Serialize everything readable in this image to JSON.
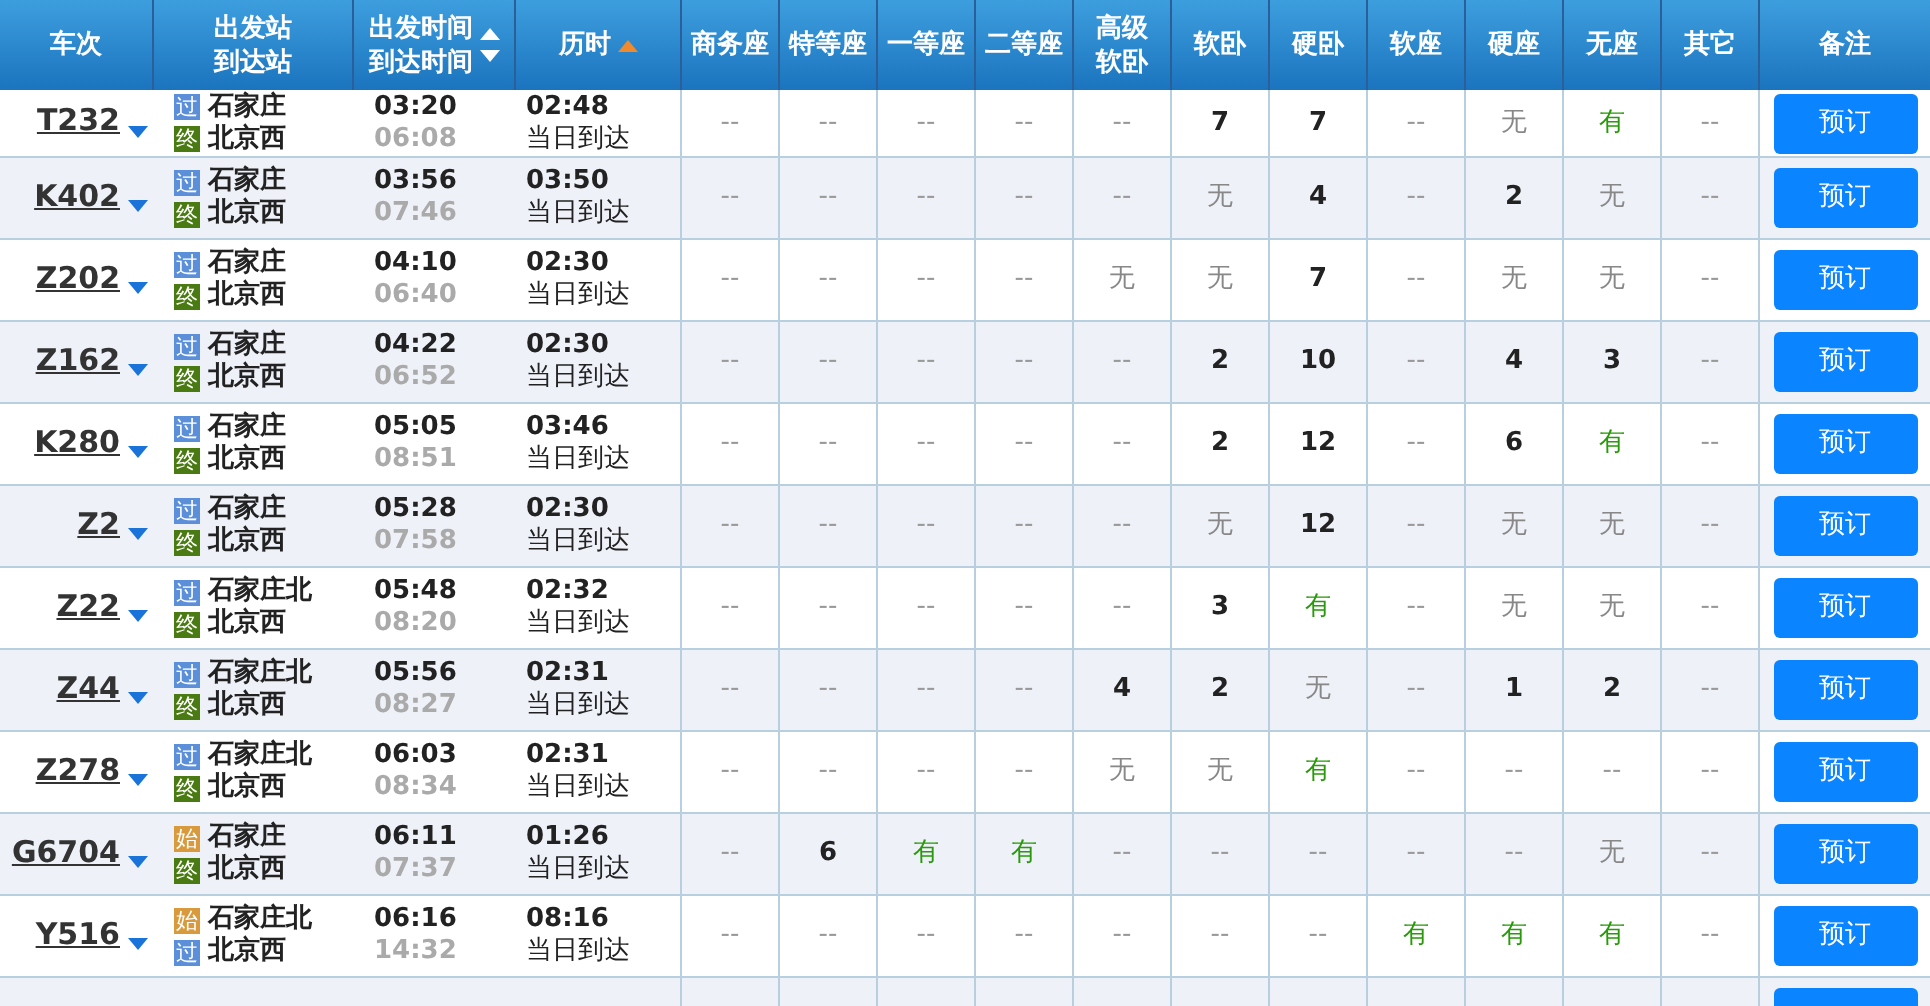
{
  "columns": [
    {
      "lines": [
        "车次"
      ]
    },
    {
      "lines": [
        "出发站",
        "到达站"
      ]
    },
    {
      "lines": [
        "出发时间",
        "到达时间"
      ],
      "sortable": true,
      "selected": false
    },
    {
      "lines": [
        "历时"
      ],
      "sortable": true,
      "selected": true
    },
    {
      "lines": [
        "商务座"
      ]
    },
    {
      "lines": [
        "特等座"
      ]
    },
    {
      "lines": [
        "一等座"
      ]
    },
    {
      "lines": [
        "二等座"
      ]
    },
    {
      "lines": [
        "高级",
        "软卧"
      ]
    },
    {
      "lines": [
        "软卧"
      ]
    },
    {
      "lines": [
        "硬卧"
      ]
    },
    {
      "lines": [
        "软座"
      ]
    },
    {
      "lines": [
        "硬座"
      ]
    },
    {
      "lines": [
        "无座"
      ]
    },
    {
      "lines": [
        "其它"
      ]
    },
    {
      "lines": [
        "备注"
      ]
    }
  ],
  "rows": [
    {
      "train": "T232",
      "from": {
        "tag": "过",
        "kind": "pass",
        "name": "石家庄"
      },
      "to": {
        "tag": "终",
        "kind": "end",
        "name": "北京西"
      },
      "depart": "03:20",
      "arrive": "06:08",
      "duration": "02:48",
      "arrival_day": "当日到达",
      "seats": [
        {
          "v": "--",
          "kind": "na"
        },
        {
          "v": "--",
          "kind": "na"
        },
        {
          "v": "--",
          "kind": "na"
        },
        {
          "v": "--",
          "kind": "na"
        },
        {
          "v": "--",
          "kind": "na"
        },
        {
          "v": "7",
          "kind": "count"
        },
        {
          "v": "7",
          "kind": "count"
        },
        {
          "v": "--",
          "kind": "na"
        },
        {
          "v": "无",
          "kind": "none"
        },
        {
          "v": "有",
          "kind": "yes"
        },
        {
          "v": "--",
          "kind": "na"
        }
      ],
      "button": "预订"
    },
    {
      "train": "K402",
      "from": {
        "tag": "过",
        "kind": "pass",
        "name": "石家庄"
      },
      "to": {
        "tag": "终",
        "kind": "end",
        "name": "北京西"
      },
      "depart": "03:56",
      "arrive": "07:46",
      "duration": "03:50",
      "arrival_day": "当日到达",
      "seats": [
        {
          "v": "--",
          "kind": "na"
        },
        {
          "v": "--",
          "kind": "na"
        },
        {
          "v": "--",
          "kind": "na"
        },
        {
          "v": "--",
          "kind": "na"
        },
        {
          "v": "--",
          "kind": "na"
        },
        {
          "v": "无",
          "kind": "none"
        },
        {
          "v": "4",
          "kind": "count"
        },
        {
          "v": "--",
          "kind": "na"
        },
        {
          "v": "2",
          "kind": "count"
        },
        {
          "v": "无",
          "kind": "none"
        },
        {
          "v": "--",
          "kind": "na"
        }
      ],
      "button": "预订"
    },
    {
      "train": "Z202",
      "from": {
        "tag": "过",
        "kind": "pass",
        "name": "石家庄"
      },
      "to": {
        "tag": "终",
        "kind": "end",
        "name": "北京西"
      },
      "depart": "04:10",
      "arrive": "06:40",
      "duration": "02:30",
      "arrival_day": "当日到达",
      "seats": [
        {
          "v": "--",
          "kind": "na"
        },
        {
          "v": "--",
          "kind": "na"
        },
        {
          "v": "--",
          "kind": "na"
        },
        {
          "v": "--",
          "kind": "na"
        },
        {
          "v": "无",
          "kind": "none"
        },
        {
          "v": "无",
          "kind": "none"
        },
        {
          "v": "7",
          "kind": "count"
        },
        {
          "v": "--",
          "kind": "na"
        },
        {
          "v": "无",
          "kind": "none"
        },
        {
          "v": "无",
          "kind": "none"
        },
        {
          "v": "--",
          "kind": "na"
        }
      ],
      "button": "预订"
    },
    {
      "train": "Z162",
      "from": {
        "tag": "过",
        "kind": "pass",
        "name": "石家庄"
      },
      "to": {
        "tag": "终",
        "kind": "end",
        "name": "北京西"
      },
      "depart": "04:22",
      "arrive": "06:52",
      "duration": "02:30",
      "arrival_day": "当日到达",
      "seats": [
        {
          "v": "--",
          "kind": "na"
        },
        {
          "v": "--",
          "kind": "na"
        },
        {
          "v": "--",
          "kind": "na"
        },
        {
          "v": "--",
          "kind": "na"
        },
        {
          "v": "--",
          "kind": "na"
        },
        {
          "v": "2",
          "kind": "count"
        },
        {
          "v": "10",
          "kind": "count"
        },
        {
          "v": "--",
          "kind": "na"
        },
        {
          "v": "4",
          "kind": "count"
        },
        {
          "v": "3",
          "kind": "count"
        },
        {
          "v": "--",
          "kind": "na"
        }
      ],
      "button": "预订"
    },
    {
      "train": "K280",
      "from": {
        "tag": "过",
        "kind": "pass",
        "name": "石家庄"
      },
      "to": {
        "tag": "终",
        "kind": "end",
        "name": "北京西"
      },
      "depart": "05:05",
      "arrive": "08:51",
      "duration": "03:46",
      "arrival_day": "当日到达",
      "seats": [
        {
          "v": "--",
          "kind": "na"
        },
        {
          "v": "--",
          "kind": "na"
        },
        {
          "v": "--",
          "kind": "na"
        },
        {
          "v": "--",
          "kind": "na"
        },
        {
          "v": "--",
          "kind": "na"
        },
        {
          "v": "2",
          "kind": "count"
        },
        {
          "v": "12",
          "kind": "count"
        },
        {
          "v": "--",
          "kind": "na"
        },
        {
          "v": "6",
          "kind": "count"
        },
        {
          "v": "有",
          "kind": "yes"
        },
        {
          "v": "--",
          "kind": "na"
        }
      ],
      "button": "预订"
    },
    {
      "train": "Z2",
      "from": {
        "tag": "过",
        "kind": "pass",
        "name": "石家庄"
      },
      "to": {
        "tag": "终",
        "kind": "end",
        "name": "北京西"
      },
      "depart": "05:28",
      "arrive": "07:58",
      "duration": "02:30",
      "arrival_day": "当日到达",
      "seats": [
        {
          "v": "--",
          "kind": "na"
        },
        {
          "v": "--",
          "kind": "na"
        },
        {
          "v": "--",
          "kind": "na"
        },
        {
          "v": "--",
          "kind": "na"
        },
        {
          "v": "--",
          "kind": "na"
        },
        {
          "v": "无",
          "kind": "none"
        },
        {
          "v": "12",
          "kind": "count"
        },
        {
          "v": "--",
          "kind": "na"
        },
        {
          "v": "无",
          "kind": "none"
        },
        {
          "v": "无",
          "kind": "none"
        },
        {
          "v": "--",
          "kind": "na"
        }
      ],
      "button": "预订"
    },
    {
      "train": "Z22",
      "from": {
        "tag": "过",
        "kind": "pass",
        "name": "石家庄北"
      },
      "to": {
        "tag": "终",
        "kind": "end",
        "name": "北京西"
      },
      "depart": "05:48",
      "arrive": "08:20",
      "duration": "02:32",
      "arrival_day": "当日到达",
      "seats": [
        {
          "v": "--",
          "kind": "na"
        },
        {
          "v": "--",
          "kind": "na"
        },
        {
          "v": "--",
          "kind": "na"
        },
        {
          "v": "--",
          "kind": "na"
        },
        {
          "v": "--",
          "kind": "na"
        },
        {
          "v": "3",
          "kind": "count"
        },
        {
          "v": "有",
          "kind": "yes"
        },
        {
          "v": "--",
          "kind": "na"
        },
        {
          "v": "无",
          "kind": "none"
        },
        {
          "v": "无",
          "kind": "none"
        },
        {
          "v": "--",
          "kind": "na"
        }
      ],
      "button": "预订"
    },
    {
      "train": "Z44",
      "from": {
        "tag": "过",
        "kind": "pass",
        "name": "石家庄北"
      },
      "to": {
        "tag": "终",
        "kind": "end",
        "name": "北京西"
      },
      "depart": "05:56",
      "arrive": "08:27",
      "duration": "02:31",
      "arrival_day": "当日到达",
      "seats": [
        {
          "v": "--",
          "kind": "na"
        },
        {
          "v": "--",
          "kind": "na"
        },
        {
          "v": "--",
          "kind": "na"
        },
        {
          "v": "--",
          "kind": "na"
        },
        {
          "v": "4",
          "kind": "count"
        },
        {
          "v": "2",
          "kind": "count"
        },
        {
          "v": "无",
          "kind": "none"
        },
        {
          "v": "--",
          "kind": "na"
        },
        {
          "v": "1",
          "kind": "count"
        },
        {
          "v": "2",
          "kind": "count"
        },
        {
          "v": "--",
          "kind": "na"
        }
      ],
      "button": "预订"
    },
    {
      "train": "Z278",
      "from": {
        "tag": "过",
        "kind": "pass",
        "name": "石家庄北"
      },
      "to": {
        "tag": "终",
        "kind": "end",
        "name": "北京西"
      },
      "depart": "06:03",
      "arrive": "08:34",
      "duration": "02:31",
      "arrival_day": "当日到达",
      "seats": [
        {
          "v": "--",
          "kind": "na"
        },
        {
          "v": "--",
          "kind": "na"
        },
        {
          "v": "--",
          "kind": "na"
        },
        {
          "v": "--",
          "kind": "na"
        },
        {
          "v": "无",
          "kind": "none"
        },
        {
          "v": "无",
          "kind": "none"
        },
        {
          "v": "有",
          "kind": "yes"
        },
        {
          "v": "--",
          "kind": "na"
        },
        {
          "v": "--",
          "kind": "na"
        },
        {
          "v": "--",
          "kind": "na"
        },
        {
          "v": "--",
          "kind": "na"
        }
      ],
      "button": "预订"
    },
    {
      "train": "G6704",
      "from": {
        "tag": "始",
        "kind": "start",
        "name": "石家庄"
      },
      "to": {
        "tag": "终",
        "kind": "end",
        "name": "北京西"
      },
      "depart": "06:11",
      "arrive": "07:37",
      "duration": "01:26",
      "arrival_day": "当日到达",
      "seats": [
        {
          "v": "--",
          "kind": "na"
        },
        {
          "v": "6",
          "kind": "count"
        },
        {
          "v": "有",
          "kind": "yes"
        },
        {
          "v": "有",
          "kind": "yes"
        },
        {
          "v": "--",
          "kind": "na"
        },
        {
          "v": "--",
          "kind": "na"
        },
        {
          "v": "--",
          "kind": "na"
        },
        {
          "v": "--",
          "kind": "na"
        },
        {
          "v": "--",
          "kind": "na"
        },
        {
          "v": "无",
          "kind": "none"
        },
        {
          "v": "--",
          "kind": "na"
        }
      ],
      "button": "预订"
    },
    {
      "train": "Y516",
      "from": {
        "tag": "始",
        "kind": "start",
        "name": "石家庄北"
      },
      "to": {
        "tag": "过",
        "kind": "pass",
        "name": "北京西"
      },
      "depart": "06:16",
      "arrive": "14:32",
      "duration": "08:16",
      "arrival_day": "当日到达",
      "seats": [
        {
          "v": "--",
          "kind": "na"
        },
        {
          "v": "--",
          "kind": "na"
        },
        {
          "v": "--",
          "kind": "na"
        },
        {
          "v": "--",
          "kind": "na"
        },
        {
          "v": "--",
          "kind": "na"
        },
        {
          "v": "--",
          "kind": "na"
        },
        {
          "v": "--",
          "kind": "na"
        },
        {
          "v": "有",
          "kind": "yes"
        },
        {
          "v": "有",
          "kind": "yes"
        },
        {
          "v": "有",
          "kind": "yes"
        },
        {
          "v": "--",
          "kind": "na"
        }
      ],
      "button": "预订"
    }
  ]
}
